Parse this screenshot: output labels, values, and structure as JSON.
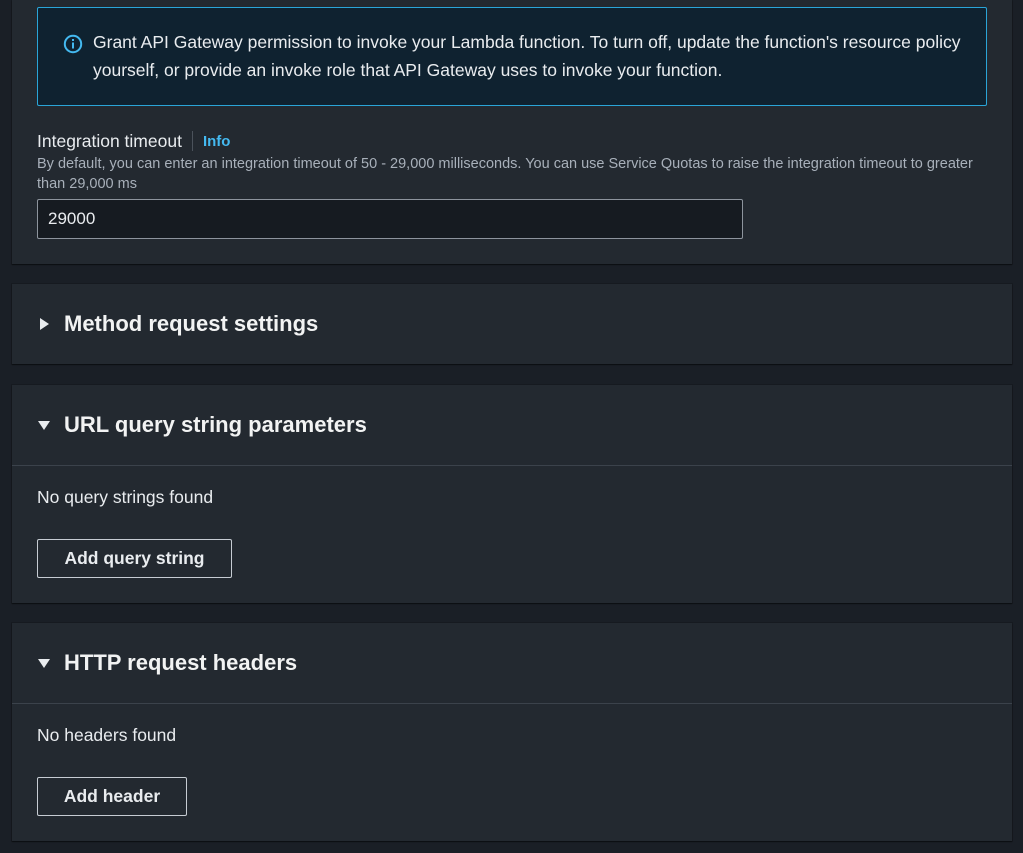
{
  "lambda_integration": {
    "alert_text": "Grant API Gateway permission to invoke your Lambda function. To turn off, update the function's resource policy yourself, or provide an invoke role that API Gateway uses to invoke your function.",
    "alert_icon": "info-circle-icon",
    "timeout_label": "Integration timeout",
    "info_link": "Info",
    "timeout_description": "By default, you can enter an integration timeout of 50 - 29,000 milliseconds. You can use Service Quotas to raise the integration timeout to greater than 29,000 ms",
    "timeout_value": "29000"
  },
  "method_request_settings": {
    "title": "Method request settings",
    "expanded": false
  },
  "url_query_string_parameters": {
    "title": "URL query string parameters",
    "expanded": true,
    "empty_text": "No query strings found",
    "add_button": "Add query string"
  },
  "http_request_headers": {
    "title": "HTTP request headers",
    "expanded": true,
    "empty_text": "No headers found",
    "add_button": "Add header"
  },
  "colors": {
    "background": "#1a1f26",
    "panel": "#232930",
    "alert_border": "#2aa5d8",
    "alert_background": "#0f2230",
    "link": "#44b9f0"
  }
}
